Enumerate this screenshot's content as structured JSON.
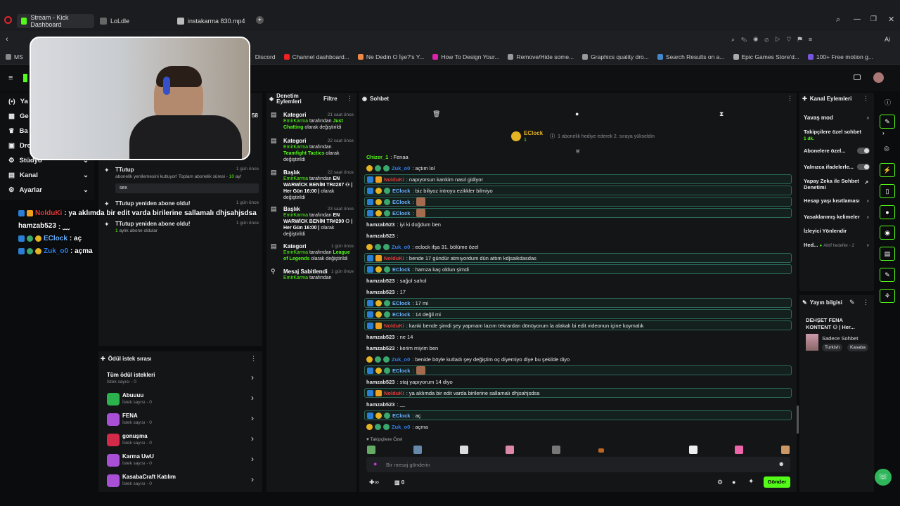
{
  "browser": {
    "tabs": [
      {
        "label": "Stream - Kick Dashboard"
      },
      {
        "label": "LoLdle"
      },
      {
        "label": "instakarma 830.mp4"
      }
    ],
    "bookmarks": [
      "MS",
      "Discord",
      "Channel dashboard...",
      "Ne Dedin O İşe?'s Y...",
      "How To Design Your...",
      "Remove/Hide some...",
      "Graphics quality dro...",
      "Search Results on a...",
      "Epic Games Store'd...",
      "100+ Free motion g..."
    ]
  },
  "sidebar": {
    "items": [
      {
        "label": "Ya"
      },
      {
        "label": "Ge"
      },
      {
        "label": "Ba"
      },
      {
        "label": "Dro"
      },
      {
        "label": "Stüdyo"
      },
      {
        "label": "Kanal"
      },
      {
        "label": "Ayarlar"
      }
    ]
  },
  "stream_overlay": {
    "time_fragment": "58",
    "messages": [
      {
        "user": "NolduKi",
        "text": ": ya aklımda bir edit varda birilerine sallamalı dhjsahjsdsa",
        "color": "#e23a3a"
      },
      {
        "user": "hamzab523",
        "text": ": ﹏",
        "color": "#ffffff"
      },
      {
        "user": "EClock",
        "text": ": aç",
        "color": "#6ab0ff"
      },
      {
        "user": "Zuk_o0",
        "text": ": açma",
        "color": "#2f7fe8"
      }
    ]
  },
  "activity": {
    "items": [
      {
        "title": "TTutup",
        "time": "1 gün önce",
        "line1": "abonelik yenilemesini kutluyor! Toplam abonelik süresi - ",
        "months": "10",
        "suffix": " ay!",
        "chip": "sex"
      },
      {
        "title": "TTutup yeniden abone oldu!",
        "time": "1 gün önce",
        "line1": "",
        "months": "",
        "suffix": ""
      },
      {
        "title": "TTutup yeniden abone oldu!",
        "time": "1 gün önce",
        "line1": "aylık abone oldular",
        "months": "1",
        "suffix": ""
      }
    ]
  },
  "rewards": {
    "title": "Ödül istek sırası",
    "all_label": "Tüm ödül istekleri",
    "all_count": "İstek sayısı - 0",
    "items": [
      {
        "name": "Abuuuu",
        "count": "İstek sayısı - 0",
        "color": "#2bb24c"
      },
      {
        "name": "FENA",
        "count": "İstek sayısı - 0",
        "color": "#a94fd6"
      },
      {
        "name": "gonuşma",
        "count": "İstek sayısı - 0",
        "color": "#d42a4a"
      },
      {
        "name": "Karma UwU",
        "count": "İstek sayısı - 0",
        "color": "#a94fd6"
      },
      {
        "name": "KasabaCraft Katılım",
        "count": "İstek sayısı - 0",
        "color": "#a94fd6"
      }
    ]
  },
  "mod_actions": {
    "title1": "Denetim",
    "title2": "Eylemleri",
    "filter": "Filtre",
    "items": [
      {
        "title": "Kategori",
        "time": "21 saat önce",
        "who": "EmirKarma",
        "mid": " tarafından ",
        "target": "Just Chatting",
        "tail": " olarak değiştirildi"
      },
      {
        "title": "Kategori",
        "time": "22 saat önce",
        "who": "EmirKarma",
        "mid": " tarafından ",
        "target": "Teamfight Tactics",
        "tail": " olarak değiştirildi"
      },
      {
        "title": "Başlık",
        "time": "22 saat önce",
        "who": "EmirKarma",
        "mid": " tarafından ",
        "target": "EN WARWİCK BENİM TR#287 ⚇ | Her Gün 16:00 |",
        "tail": " olarak değiştirildi"
      },
      {
        "title": "Başlık",
        "time": "23 saat önce",
        "who": "EmirKarma",
        "mid": " tarafından ",
        "target": "EN WARWİCK BENİM TR#290 ⚇ | Her Gün 16:00 |",
        "tail": " olarak değiştirildi"
      },
      {
        "title": "Kategori",
        "time": "1 gün önce",
        "who": "EmirKarma",
        "mid": " tarafından ",
        "target": "League of Legends",
        "tail": " olarak değiştirildi"
      },
      {
        "title": "Mesaj Sabitlendi",
        "time": "1 gün önce",
        "who": "EmirKarma",
        "mid": " tarafından",
        "target": "",
        "tail": ""
      }
    ]
  },
  "chat": {
    "title": "Sohbet",
    "gift_user": "EClock",
    "gift_count": "1",
    "gift_text": "1 abonelik hediye ederek 2. sıraya yükseldin",
    "messages": [
      {
        "user": "Chizer_1",
        "text": ": Fenaa",
        "ucolor": "#53fc18",
        "hl": false,
        "badges": []
      },
      {
        "user": "Zuk_o0",
        "text": ": açtım lol",
        "ucolor": "#2f7fe8",
        "hl": false,
        "badges": [
          "gold",
          "grn",
          "grn"
        ]
      },
      {
        "user": "NolduKi",
        "text": ": napıyorsun kankim nasıl gidiyor",
        "ucolor": "#e23a3a",
        "hl": true,
        "badges": [
          "blue",
          "or"
        ]
      },
      {
        "user": "EClock",
        "text": ": biz biliyoz introyu ezikkler bilmiyo",
        "ucolor": "#6ab0ff",
        "hl": true,
        "badges": [
          "blue",
          "gold",
          "grn"
        ]
      },
      {
        "user": "EClock",
        "text": ":",
        "ucolor": "#6ab0ff",
        "hl": true,
        "badges": [
          "blue",
          "gold",
          "grn"
        ],
        "emote": true
      },
      {
        "user": "EClock",
        "text": ":",
        "ucolor": "#6ab0ff",
        "hl": true,
        "badges": [
          "blue",
          "gold",
          "grn"
        ],
        "emote": true
      },
      {
        "user": "hamzab523",
        "text": ": iyi ki doğdum ben",
        "ucolor": "#e8e8e8",
        "hl": false,
        "badges": []
      },
      {
        "user": "hamzab523",
        "text": ": ",
        "ucolor": "#e8e8e8",
        "hl": false,
        "badges": []
      },
      {
        "user": "Zuk_o0",
        "text": ": eclock ifşa 31. bölüme özel",
        "ucolor": "#2f7fe8",
        "hl": false,
        "badges": [
          "gold",
          "grn",
          "grn"
        ]
      },
      {
        "user": "NolduKi",
        "text": ": bende 17 gündür atmıyordum dün attım kdjsaikdasdas",
        "ucolor": "#e23a3a",
        "hl": true,
        "badges": [
          "blue",
          "or"
        ]
      },
      {
        "user": "EClock",
        "text": ": hamza kaç oldun şimdi",
        "ucolor": "#6ab0ff",
        "hl": true,
        "badges": [
          "blue",
          "gold",
          "grn"
        ]
      },
      {
        "user": "hamzab523",
        "text": ": sağol sahol",
        "ucolor": "#e8e8e8",
        "hl": false,
        "badges": []
      },
      {
        "user": "hamzab523",
        "text": ": 17",
        "ucolor": "#e8e8e8",
        "hl": false,
        "badges": []
      },
      {
        "user": "EClock",
        "text": ": 17 mi",
        "ucolor": "#6ab0ff",
        "hl": true,
        "badges": [
          "blue",
          "gold",
          "grn"
        ]
      },
      {
        "user": "EClock",
        "text": ": 14 değil mi",
        "ucolor": "#6ab0ff",
        "hl": true,
        "badges": [
          "blue",
          "gold",
          "grn"
        ]
      },
      {
        "user": "NolduKi",
        "text": ": kanki bende şimdi şey yapmam lazım tekrardan dönüyorum la alakalı bi edit videonun içine koymalık",
        "ucolor": "#e23a3a",
        "hl": true,
        "badges": [
          "blue",
          "or"
        ]
      },
      {
        "user": "hamzab523",
        "text": ": ne 14",
        "ucolor": "#e8e8e8",
        "hl": false,
        "badges": []
      },
      {
        "user": "hamzab523",
        "text": ": kerim miyim ben",
        "ucolor": "#e8e8e8",
        "hl": false,
        "badges": []
      },
      {
        "user": "Zuk_o0",
        "text": ": benide böyle kutladı şey değiştim oç diyemiyo diye bu şekilde diyo",
        "ucolor": "#2f7fe8",
        "hl": false,
        "badges": [
          "gold",
          "grn",
          "grn"
        ]
      },
      {
        "user": "EClock",
        "text": ":",
        "ucolor": "#6ab0ff",
        "hl": true,
        "badges": [
          "blue",
          "gold",
          "grn"
        ],
        "emote": true
      },
      {
        "user": "hamzab523",
        "text": ": staj yapıyorum 14 diyo",
        "ucolor": "#e8e8e8",
        "hl": false,
        "badges": []
      },
      {
        "user": "NolduKi",
        "text": ": ya aklımda bir edit varda birilerine sallamalı dhjsahjsdsa",
        "ucolor": "#e23a3a",
        "hl": true,
        "badges": [
          "blue",
          "or"
        ]
      },
      {
        "user": "hamzab523",
        "text": ": ﹏",
        "ucolor": "#e8e8e8",
        "hl": false,
        "badges": []
      },
      {
        "user": "EClock",
        "text": ": aç",
        "ucolor": "#6ab0ff",
        "hl": true,
        "badges": [
          "blue",
          "gold",
          "grn"
        ]
      },
      {
        "user": "Zuk_o0",
        "text": ": açma",
        "ucolor": "#2f7fe8",
        "hl": false,
        "badges": [
          "gold",
          "grn",
          "grn"
        ]
      }
    ],
    "emote_bar_label": "Takipçilere Özel",
    "input_placeholder": "Bir mesaj gönderin",
    "points": "0",
    "send_label": "Gönder"
  },
  "channel_actions": {
    "title": "Kanal Eylemleri",
    "items": [
      {
        "label": "Yavaş mod"
      },
      {
        "label": "Takipçilere özel sohbet",
        "sub": "1 dk."
      },
      {
        "label": "Abonelere özel..."
      },
      {
        "label": "Yalnızca ifadelerle..."
      },
      {
        "label": "Yapay Zeka ile Sohbet Denetimi"
      },
      {
        "label": "Hesap yaşı kısıtlaması"
      },
      {
        "label": "Yasaklanmış kelimeler"
      },
      {
        "label": "İzleyici Yönlendir"
      },
      {
        "label": "Hed...",
        "sub": "Aktif hedefler - 2"
      }
    ]
  },
  "stream_info": {
    "title": "Yayın bilgisi",
    "stream_title": "DEHŞET FENA KONTENT ⚇ | Her...",
    "subtitle": "Sadece Sohbet",
    "tags": [
      "Turkish",
      "Kasaba"
    ]
  },
  "colors": {
    "accent": "#53fc18",
    "panel": "#141517"
  }
}
